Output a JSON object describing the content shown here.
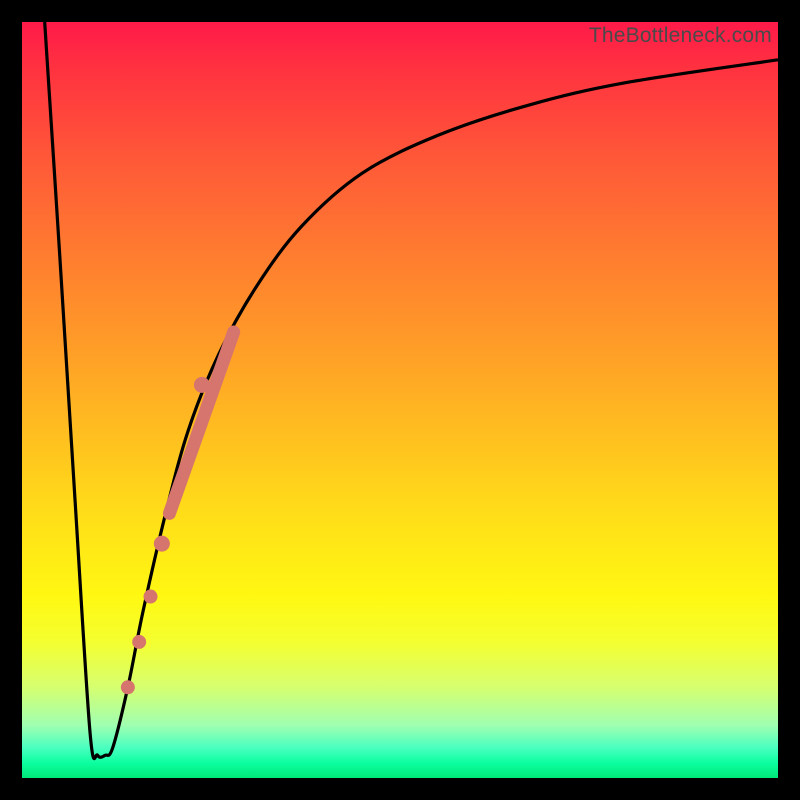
{
  "watermark": "TheBottleneck.com",
  "colors": {
    "curve": "#000000",
    "marker": "#d6756d",
    "frame": "#000000"
  },
  "chart_data": {
    "type": "line",
    "title": "",
    "xlabel": "",
    "ylabel": "",
    "xlim": [
      0,
      100
    ],
    "ylim": [
      0,
      100
    ],
    "note": "Axes are unlabeled in the source; x/y represent normalized 0–100 extents of the plot area. Curve drops from (3,100) to a flat trough near y≈3 over x≈9–12, then rises asymptotically toward y≈95 at x≈100.",
    "series": [
      {
        "name": "bottleneck-curve",
        "x": [
          3,
          5,
          7,
          9,
          10,
          11,
          12,
          14,
          16,
          19,
          22,
          26,
          31,
          37,
          45,
          55,
          67,
          80,
          100
        ],
        "y": [
          100,
          69,
          37,
          6,
          3,
          3,
          4,
          12,
          22,
          35,
          46,
          56,
          65,
          73,
          80,
          85,
          89,
          92,
          95
        ]
      }
    ],
    "markers": {
      "name": "highlighted-segment",
      "comment": "Pink dotted accents along the rising limb of the curve.",
      "points": [
        {
          "x": 14.0,
          "y": 12
        },
        {
          "x": 15.5,
          "y": 18
        },
        {
          "x": 17.0,
          "y": 24
        },
        {
          "x": 18.5,
          "y": 31
        },
        {
          "x": 23.8,
          "y": 52
        }
      ],
      "stroke_segment": {
        "x1": 19.5,
        "y1": 35,
        "x2": 28.0,
        "y2": 59
      }
    }
  }
}
